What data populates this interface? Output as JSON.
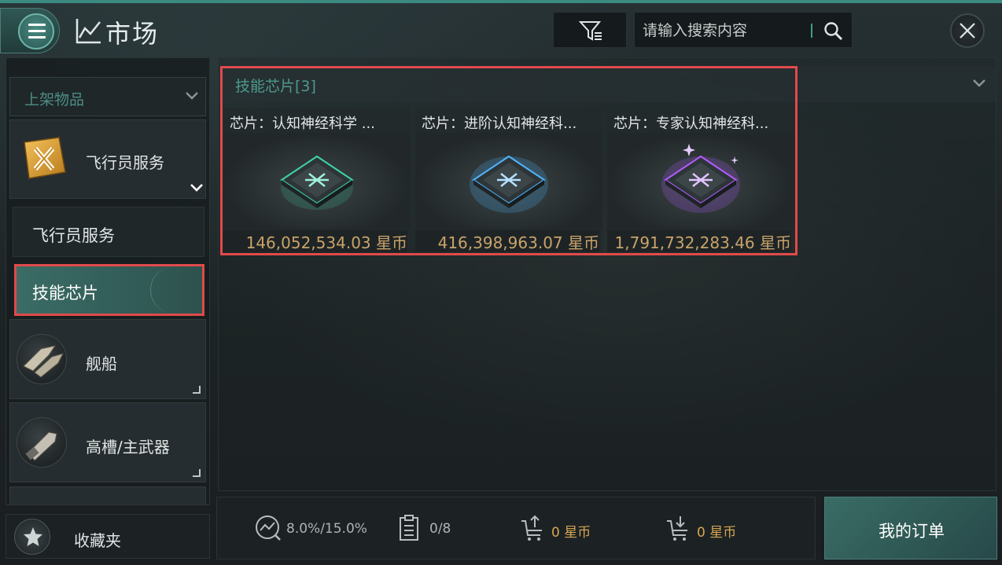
{
  "header": {
    "title": "市场",
    "search": {
      "placeholder": "请输入搜索内容",
      "value": ""
    },
    "icons": [
      "menu-icon",
      "market-chart-icon",
      "filter-icon",
      "search-icon",
      "close-icon"
    ]
  },
  "sidebar": {
    "listing_dropdown": "上架物品",
    "categories": [
      {
        "label": "飞行员服务",
        "icon": "pilot-services-icon",
        "expanded": true
      },
      {
        "label": "舰船",
        "icon": "ship-icon"
      },
      {
        "label": "高槽/主武器",
        "icon": "weapon-icon"
      }
    ],
    "subcategories": [
      {
        "label": "飞行员服务",
        "selected": false
      },
      {
        "label": "技能芯片",
        "selected": true
      }
    ],
    "favorites": "收藏夹"
  },
  "main": {
    "group_title": "技能芯片[3]",
    "items": [
      {
        "name": "芯片：认知神经科学 ...",
        "price": "146,052,534.03 星币",
        "glow": "#3fd3a8"
      },
      {
        "name": "芯片：进阶认知神经科...",
        "price": "416,398,963.07 星币",
        "glow": "#4fb4ff"
      },
      {
        "name": "芯片：专家认知神经科...",
        "price": "1,791,732,283.46 星币",
        "glow": "#b25cff"
      }
    ]
  },
  "stats": {
    "tax": "8.0%/15.0%",
    "orders": "0/8",
    "sell_total": "0 星币",
    "buy_total": "0 星币"
  },
  "my_orders_label": "我的订单",
  "colors": {
    "accent": "#3b8a80",
    "highlight": "#e14a4a",
    "price": "#c9a36a",
    "currency": "#d7a651"
  }
}
